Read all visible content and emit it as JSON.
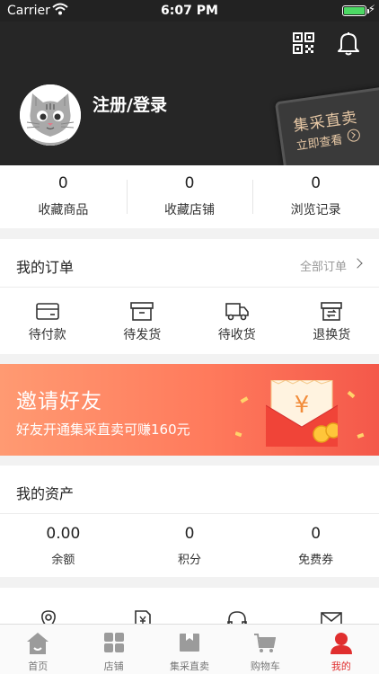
{
  "status_bar": {
    "carrier": "Carrier",
    "time": "6:07 PM"
  },
  "header": {
    "login_label": "注册/登录",
    "promo": {
      "title": "集采直卖",
      "subtitle": "立即查看"
    }
  },
  "stats": [
    {
      "value": "0",
      "label": "收藏商品"
    },
    {
      "value": "0",
      "label": "收藏店铺"
    },
    {
      "value": "0",
      "label": "浏览记录"
    }
  ],
  "orders": {
    "title": "我的订单",
    "all_label": "全部订单",
    "items": [
      {
        "label": "待付款",
        "icon": "card-icon"
      },
      {
        "label": "待发货",
        "icon": "box-icon"
      },
      {
        "label": "待收货",
        "icon": "truck-icon"
      },
      {
        "label": "退换货",
        "icon": "exchange-icon"
      }
    ]
  },
  "banner": {
    "title": "邀请好友",
    "subtitle": "好友开通集采直卖可赚160元",
    "envelope_symbol": "¥"
  },
  "assets": {
    "title": "我的资产",
    "items": [
      {
        "value": "0.00",
        "label": "余额"
      },
      {
        "value": "0",
        "label": "积分"
      },
      {
        "value": "0",
        "label": "免费券"
      }
    ]
  },
  "tabbar": [
    {
      "label": "首页",
      "icon": "home-icon",
      "active": false
    },
    {
      "label": "店铺",
      "icon": "grid-icon",
      "active": false
    },
    {
      "label": "集采直卖",
      "icon": "store-icon",
      "active": false
    },
    {
      "label": "购物车",
      "icon": "cart-icon",
      "active": false
    },
    {
      "label": "我的",
      "icon": "person-icon",
      "active": true
    }
  ],
  "colors": {
    "accent": "#e02e2e",
    "header_bg": "#262626",
    "promo_text": "#e8c9a6"
  }
}
